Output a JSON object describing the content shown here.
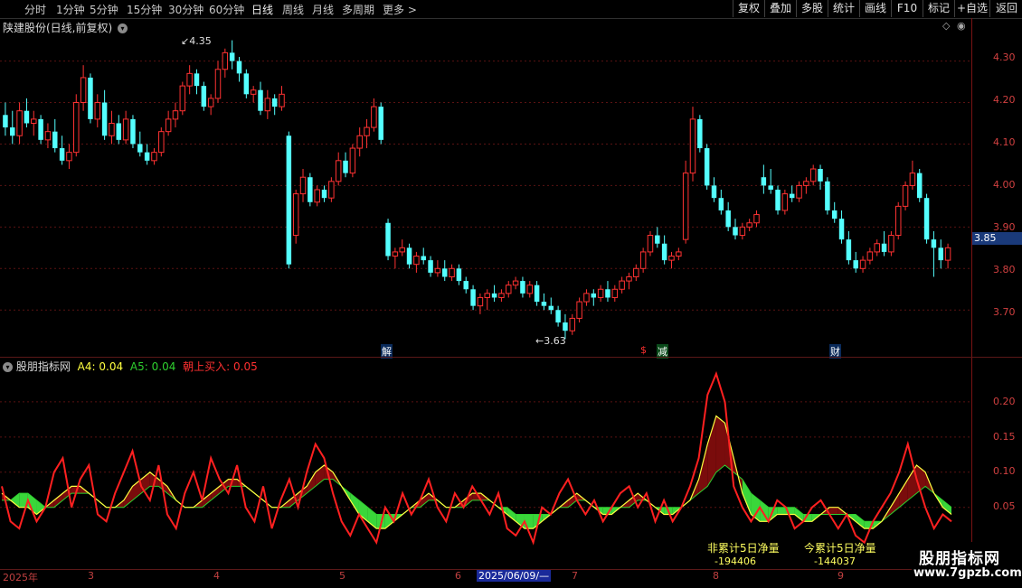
{
  "toolbar": {
    "periods": [
      "分时",
      "1分钟",
      "5分钟",
      "15分钟",
      "30分钟",
      "60分钟",
      "日线",
      "周线",
      "月线",
      "多周期",
      "更多 >"
    ],
    "active_period": "日线",
    "buttons": [
      "复权",
      "叠加",
      "多股",
      "统计",
      "画线",
      "F10",
      "标记",
      "+自选",
      "返回"
    ]
  },
  "main": {
    "title": "陕建股份(日线,前复权)",
    "price_axis": [
      "4.30",
      "4.20",
      "4.10",
      "4.00",
      "3.90",
      "3.80",
      "3.70"
    ],
    "current_price": "3.85",
    "high_annotation": "4.35",
    "low_annotation": "3.63",
    "event_markers": [
      "解",
      "$",
      "减",
      "财"
    ]
  },
  "indicator": {
    "name": "股朋指标网",
    "a4_label": "A4: 0.04",
    "a5_label": "A5: 0.04",
    "buy_label": "朝上买入: 0.05",
    "axis": [
      "0.20",
      "0.15",
      "0.10",
      "0.05"
    ],
    "non_cum_label": "非累计5日净量",
    "non_cum_value": "-194406",
    "cum_label": "今累计5日净量",
    "cum_value": "-144037"
  },
  "date_axis": {
    "year": "2025年",
    "months": [
      "3",
      "4",
      "5",
      "6",
      "7",
      "8",
      "9"
    ],
    "cursor_date": "2025/06/09/—"
  },
  "watermark": {
    "title": "股朋指标网",
    "url": "www.7gpzb.com"
  },
  "colors": {
    "up": "#ff3232",
    "down": "#54ffff",
    "green_fill": "#3ad63a",
    "red_fill": "#7a0c0c",
    "yellow_line": "#ffff40",
    "green_line": "#2fd02f",
    "red_line": "#ff2020"
  },
  "chart_data": {
    "type": "candlestick",
    "y_range": [
      3.62,
      4.36
    ],
    "candles": [
      [
        4.17,
        4.2,
        4.12,
        4.14
      ],
      [
        4.14,
        4.18,
        4.1,
        4.12
      ],
      [
        4.12,
        4.2,
        4.1,
        4.18
      ],
      [
        4.18,
        4.21,
        4.14,
        4.15
      ],
      [
        4.15,
        4.18,
        4.12,
        4.16
      ],
      [
        4.16,
        4.17,
        4.1,
        4.11
      ],
      [
        4.11,
        4.15,
        4.09,
        4.13
      ],
      [
        4.13,
        4.16,
        4.08,
        4.09
      ],
      [
        4.09,
        4.12,
        4.05,
        4.06
      ],
      [
        4.06,
        4.1,
        4.04,
        4.08
      ],
      [
        4.08,
        4.22,
        4.07,
        4.2
      ],
      [
        4.2,
        4.29,
        4.18,
        4.26
      ],
      [
        4.26,
        4.27,
        4.15,
        4.16
      ],
      [
        4.16,
        4.22,
        4.14,
        4.2
      ],
      [
        4.2,
        4.23,
        4.11,
        4.12
      ],
      [
        4.12,
        4.18,
        4.1,
        4.15
      ],
      [
        4.15,
        4.17,
        4.1,
        4.11
      ],
      [
        4.11,
        4.18,
        4.1,
        4.16
      ],
      [
        4.16,
        4.17,
        4.09,
        4.1
      ],
      [
        4.1,
        4.13,
        4.07,
        4.08
      ],
      [
        4.08,
        4.1,
        4.05,
        4.06
      ],
      [
        4.06,
        4.09,
        4.05,
        4.08
      ],
      [
        4.08,
        4.14,
        4.07,
        4.13
      ],
      [
        4.13,
        4.18,
        4.12,
        4.16
      ],
      [
        4.16,
        4.2,
        4.14,
        4.18
      ],
      [
        4.18,
        4.25,
        4.17,
        4.24
      ],
      [
        4.24,
        4.29,
        4.22,
        4.27
      ],
      [
        4.27,
        4.28,
        4.22,
        4.24
      ],
      [
        4.24,
        4.25,
        4.18,
        4.19
      ],
      [
        4.19,
        4.22,
        4.17,
        4.21
      ],
      [
        4.21,
        4.3,
        4.2,
        4.28
      ],
      [
        4.28,
        4.33,
        4.26,
        4.32
      ],
      [
        4.32,
        4.35,
        4.28,
        4.3
      ],
      [
        4.3,
        4.31,
        4.25,
        4.27
      ],
      [
        4.27,
        4.28,
        4.21,
        4.22
      ],
      [
        4.22,
        4.24,
        4.2,
        4.23
      ],
      [
        4.23,
        4.25,
        4.17,
        4.18
      ],
      [
        4.18,
        4.23,
        4.16,
        4.21
      ],
      [
        4.21,
        4.22,
        4.17,
        4.19
      ],
      [
        4.19,
        4.24,
        4.18,
        4.22
      ],
      [
        4.12,
        4.13,
        3.8,
        3.81
      ],
      [
        3.88,
        3.99,
        3.86,
        3.98
      ],
      [
        3.98,
        4.04,
        3.96,
        4.02
      ],
      [
        4.02,
        4.03,
        3.95,
        3.96
      ],
      [
        3.96,
        4.0,
        3.95,
        3.99
      ],
      [
        3.99,
        4.0,
        3.96,
        3.97
      ],
      [
        3.97,
        4.02,
        3.96,
        4.01
      ],
      [
        4.01,
        4.08,
        4.0,
        4.06
      ],
      [
        4.06,
        4.08,
        4.02,
        4.03
      ],
      [
        4.03,
        4.1,
        4.02,
        4.09
      ],
      [
        4.09,
        4.14,
        4.07,
        4.12
      ],
      [
        4.12,
        4.16,
        4.09,
        4.14
      ],
      [
        4.14,
        4.21,
        4.13,
        4.19
      ],
      [
        4.19,
        4.2,
        4.1,
        4.11
      ],
      [
        3.91,
        3.92,
        3.82,
        3.83
      ],
      [
        3.83,
        3.85,
        3.8,
        3.84
      ],
      [
        3.84,
        3.87,
        3.83,
        3.85
      ],
      [
        3.85,
        3.86,
        3.8,
        3.81
      ],
      [
        3.81,
        3.84,
        3.79,
        3.83
      ],
      [
        3.83,
        3.85,
        3.81,
        3.82
      ],
      [
        3.82,
        3.83,
        3.78,
        3.79
      ],
      [
        3.79,
        3.82,
        3.78,
        3.8
      ],
      [
        3.8,
        3.82,
        3.77,
        3.78
      ],
      [
        3.78,
        3.81,
        3.77,
        3.8
      ],
      [
        3.8,
        3.81,
        3.76,
        3.77
      ],
      [
        3.77,
        3.78,
        3.74,
        3.75
      ],
      [
        3.75,
        3.76,
        3.7,
        3.71
      ],
      [
        3.71,
        3.74,
        3.69,
        3.73
      ],
      [
        3.73,
        3.75,
        3.7,
        3.74
      ],
      [
        3.74,
        3.76,
        3.72,
        3.73
      ],
      [
        3.73,
        3.75,
        3.72,
        3.74
      ],
      [
        3.74,
        3.77,
        3.73,
        3.76
      ],
      [
        3.76,
        3.78,
        3.75,
        3.77
      ],
      [
        3.77,
        3.78,
        3.73,
        3.74
      ],
      [
        3.74,
        3.77,
        3.73,
        3.76
      ],
      [
        3.76,
        3.77,
        3.71,
        3.72
      ],
      [
        3.72,
        3.74,
        3.7,
        3.71
      ],
      [
        3.71,
        3.73,
        3.69,
        3.7
      ],
      [
        3.7,
        3.71,
        3.66,
        3.67
      ],
      [
        3.67,
        3.69,
        3.63,
        3.65
      ],
      [
        3.65,
        3.69,
        3.64,
        3.68
      ],
      [
        3.68,
        3.73,
        3.67,
        3.72
      ],
      [
        3.72,
        3.75,
        3.71,
        3.74
      ],
      [
        3.74,
        3.75,
        3.71,
        3.73
      ],
      [
        3.73,
        3.76,
        3.72,
        3.75
      ],
      [
        3.75,
        3.77,
        3.72,
        3.73
      ],
      [
        3.73,
        3.76,
        3.72,
        3.75
      ],
      [
        3.75,
        3.78,
        3.74,
        3.77
      ],
      [
        3.77,
        3.79,
        3.75,
        3.78
      ],
      [
        3.78,
        3.81,
        3.77,
        3.8
      ],
      [
        3.8,
        3.85,
        3.79,
        3.84
      ],
      [
        3.84,
        3.89,
        3.83,
        3.88
      ],
      [
        3.88,
        3.9,
        3.85,
        3.86
      ],
      [
        3.86,
        3.88,
        3.81,
        3.82
      ],
      [
        3.82,
        3.84,
        3.8,
        3.83
      ],
      [
        3.83,
        3.85,
        3.82,
        3.84
      ],
      [
        3.87,
        4.06,
        3.86,
        4.03
      ],
      [
        4.03,
        4.19,
        4.01,
        4.16
      ],
      [
        4.16,
        4.17,
        4.08,
        4.09
      ],
      [
        4.09,
        4.1,
        3.99,
        4.0
      ],
      [
        4.0,
        4.02,
        3.96,
        3.97
      ],
      [
        3.97,
        3.99,
        3.93,
        3.94
      ],
      [
        3.94,
        3.96,
        3.89,
        3.9
      ],
      [
        3.9,
        3.92,
        3.87,
        3.88
      ],
      [
        3.88,
        3.91,
        3.87,
        3.9
      ],
      [
        3.9,
        3.92,
        3.89,
        3.91
      ],
      [
        3.91,
        3.94,
        3.9,
        3.93
      ],
      [
        4.02,
        4.05,
        3.98,
        4.0
      ],
      [
        4.0,
        4.04,
        3.98,
        3.99
      ],
      [
        3.99,
        4.0,
        3.93,
        3.94
      ],
      [
        3.94,
        3.99,
        3.93,
        3.98
      ],
      [
        3.98,
        4.0,
        3.96,
        3.97
      ],
      [
        3.97,
        4.01,
        3.96,
        4.0
      ],
      [
        4.0,
        4.02,
        3.98,
        4.01
      ],
      [
        4.01,
        4.05,
        4.0,
        4.04
      ],
      [
        4.04,
        4.05,
        3.99,
        4.01
      ],
      [
        4.01,
        4.02,
        3.93,
        3.94
      ],
      [
        3.94,
        3.96,
        3.91,
        3.92
      ],
      [
        3.92,
        3.94,
        3.86,
        3.87
      ],
      [
        3.87,
        3.89,
        3.81,
        3.82
      ],
      [
        3.82,
        3.84,
        3.79,
        3.8
      ],
      [
        3.8,
        3.83,
        3.79,
        3.82
      ],
      [
        3.82,
        3.85,
        3.81,
        3.84
      ],
      [
        3.84,
        3.87,
        3.83,
        3.86
      ],
      [
        3.86,
        3.89,
        3.83,
        3.84
      ],
      [
        3.84,
        3.89,
        3.83,
        3.88
      ],
      [
        3.88,
        3.96,
        3.87,
        3.95
      ],
      [
        3.95,
        4.01,
        3.94,
        4.0
      ],
      [
        4.0,
        4.06,
        3.99,
        4.03
      ],
      [
        4.03,
        4.04,
        3.96,
        3.97
      ],
      [
        3.97,
        3.98,
        3.86,
        3.87
      ],
      [
        3.87,
        3.89,
        3.78,
        3.85
      ],
      [
        3.85,
        3.87,
        3.8,
        3.82
      ],
      [
        3.82,
        3.86,
        3.8,
        3.85
      ]
    ],
    "indicator_series": {
      "y_range": [
        -0.03,
        0.25
      ],
      "a4": [
        0.07,
        0.06,
        0.05,
        0.05,
        0.04,
        0.05,
        0.06,
        0.07,
        0.08,
        0.08,
        0.07,
        0.06,
        0.05,
        0.05,
        0.06,
        0.08,
        0.09,
        0.1,
        0.09,
        0.08,
        0.06,
        0.05,
        0.05,
        0.06,
        0.07,
        0.08,
        0.09,
        0.09,
        0.08,
        0.07,
        0.06,
        0.05,
        0.05,
        0.06,
        0.07,
        0.08,
        0.1,
        0.11,
        0.1,
        0.08,
        0.06,
        0.04,
        0.03,
        0.02,
        0.02,
        0.03,
        0.04,
        0.05,
        0.06,
        0.07,
        0.06,
        0.05,
        0.05,
        0.06,
        0.07,
        0.07,
        0.06,
        0.05,
        0.04,
        0.03,
        0.02,
        0.02,
        0.03,
        0.04,
        0.05,
        0.06,
        0.07,
        0.06,
        0.05,
        0.04,
        0.04,
        0.05,
        0.06,
        0.07,
        0.06,
        0.05,
        0.04,
        0.04,
        0.05,
        0.06,
        0.09,
        0.14,
        0.18,
        0.17,
        0.12,
        0.07,
        0.04,
        0.03,
        0.03,
        0.04,
        0.04,
        0.04,
        0.03,
        0.03,
        0.04,
        0.05,
        0.05,
        0.04,
        0.03,
        0.02,
        0.02,
        0.03,
        0.05,
        0.07,
        0.09,
        0.11,
        0.1,
        0.07,
        0.05,
        0.04
      ],
      "a5": [
        0.06,
        0.06,
        0.07,
        0.07,
        0.06,
        0.05,
        0.05,
        0.06,
        0.07,
        0.07,
        0.07,
        0.06,
        0.05,
        0.05,
        0.05,
        0.06,
        0.07,
        0.08,
        0.08,
        0.07,
        0.06,
        0.05,
        0.05,
        0.05,
        0.06,
        0.07,
        0.08,
        0.08,
        0.08,
        0.07,
        0.06,
        0.05,
        0.05,
        0.05,
        0.06,
        0.07,
        0.08,
        0.09,
        0.09,
        0.08,
        0.07,
        0.06,
        0.05,
        0.04,
        0.04,
        0.04,
        0.04,
        0.05,
        0.05,
        0.06,
        0.06,
        0.05,
        0.05,
        0.05,
        0.06,
        0.06,
        0.06,
        0.05,
        0.05,
        0.04,
        0.04,
        0.04,
        0.04,
        0.04,
        0.05,
        0.05,
        0.06,
        0.06,
        0.05,
        0.05,
        0.05,
        0.05,
        0.05,
        0.06,
        0.06,
        0.05,
        0.05,
        0.05,
        0.05,
        0.06,
        0.07,
        0.08,
        0.1,
        0.11,
        0.1,
        0.09,
        0.07,
        0.06,
        0.05,
        0.05,
        0.05,
        0.05,
        0.04,
        0.04,
        0.04,
        0.04,
        0.04,
        0.04,
        0.04,
        0.03,
        0.03,
        0.03,
        0.04,
        0.05,
        0.06,
        0.07,
        0.08,
        0.07,
        0.06,
        0.05
      ],
      "buy": [
        0.08,
        0.03,
        0.02,
        0.06,
        0.03,
        0.05,
        0.1,
        0.12,
        0.05,
        0.09,
        0.11,
        0.04,
        0.03,
        0.07,
        0.1,
        0.13,
        0.08,
        0.06,
        0.11,
        0.04,
        0.02,
        0.07,
        0.1,
        0.06,
        0.12,
        0.09,
        0.07,
        0.11,
        0.05,
        0.03,
        0.08,
        0.02,
        0.06,
        0.09,
        0.05,
        0.1,
        0.14,
        0.12,
        0.07,
        0.03,
        0.01,
        0.04,
        0.02,
        0.0,
        0.05,
        0.03,
        0.07,
        0.04,
        0.06,
        0.09,
        0.05,
        0.03,
        0.07,
        0.05,
        0.08,
        0.06,
        0.04,
        0.07,
        0.02,
        0.01,
        0.03,
        0.0,
        0.05,
        0.04,
        0.07,
        0.09,
        0.06,
        0.04,
        0.06,
        0.03,
        0.05,
        0.07,
        0.08,
        0.05,
        0.07,
        0.03,
        0.06,
        0.03,
        0.05,
        0.08,
        0.12,
        0.21,
        0.24,
        0.2,
        0.08,
        0.05,
        0.03,
        0.05,
        0.03,
        0.06,
        0.05,
        0.02,
        0.03,
        0.05,
        0.06,
        0.04,
        0.02,
        0.04,
        0.01,
        0.0,
        0.03,
        0.05,
        0.07,
        0.1,
        0.14,
        0.09,
        0.05,
        0.02,
        0.04,
        0.03
      ]
    }
  }
}
